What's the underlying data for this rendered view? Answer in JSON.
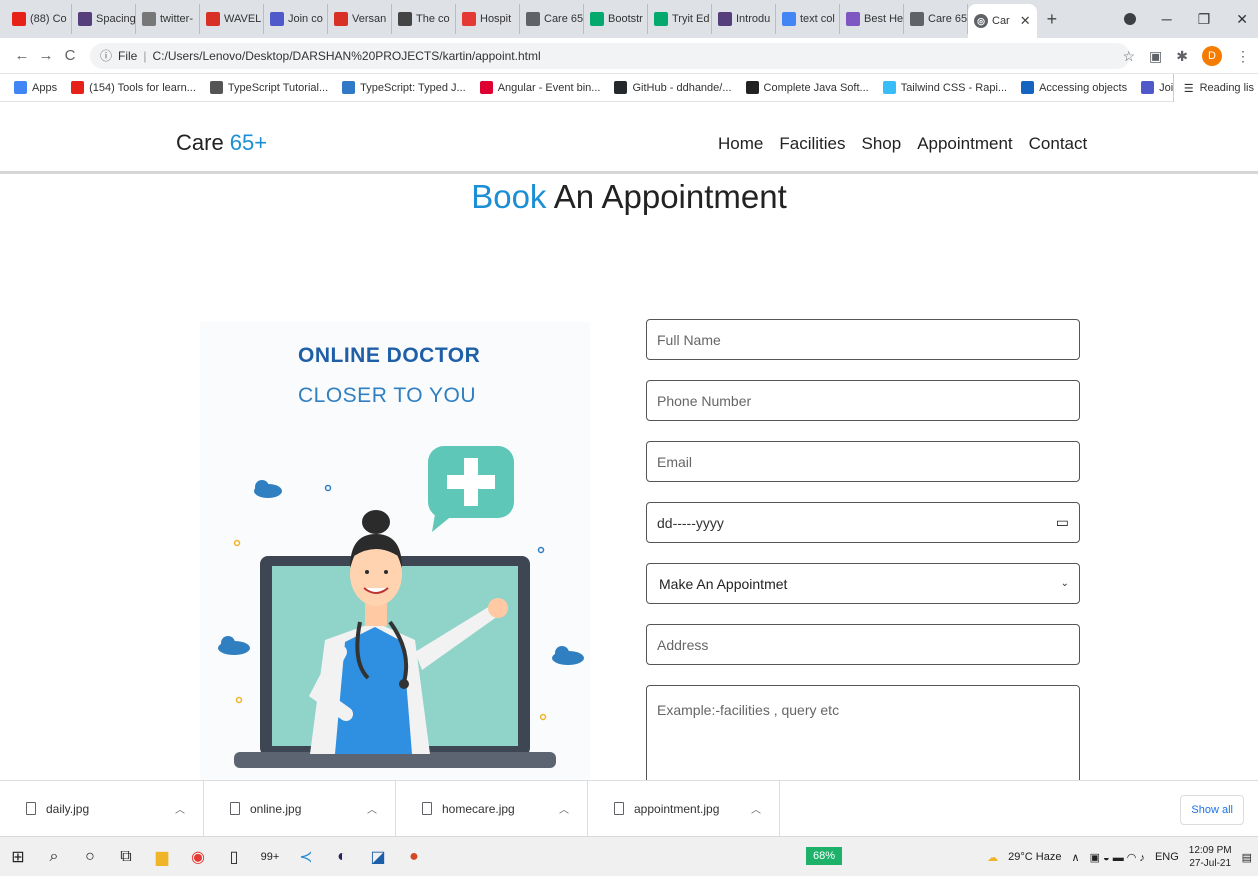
{
  "browser": {
    "tabs": [
      {
        "label": "(88) Co",
        "icon": "youtube-icon",
        "color": "#e62117"
      },
      {
        "label": "Spacing",
        "icon": "bootstrap-icon",
        "color": "#563d7c"
      },
      {
        "label": "twitter-",
        "icon": "code-icon",
        "color": "#777777"
      },
      {
        "label": "WAVEL",
        "icon": "gmail-icon",
        "color": "#d93025"
      },
      {
        "label": "Join co",
        "icon": "teams-icon",
        "color": "#5059c9"
      },
      {
        "label": "Versan",
        "icon": "gmail-icon",
        "color": "#d93025"
      },
      {
        "label": "The co",
        "icon": "arrows-icon",
        "color": "#444444"
      },
      {
        "label": "Hospit",
        "icon": "hospital-icon",
        "color": "#e53935"
      },
      {
        "label": "Care 65",
        "icon": "globe-icon",
        "color": "#5f6368"
      },
      {
        "label": "Bootstr",
        "icon": "w3-icon",
        "color": "#04aa6d"
      },
      {
        "label": "Tryit Ed",
        "icon": "w3-icon",
        "color": "#04aa6d"
      },
      {
        "label": "Introdu",
        "icon": "bootstrap-icon",
        "color": "#563d7c"
      },
      {
        "label": "text col",
        "icon": "google-icon",
        "color": "#4285f4"
      },
      {
        "label": "Best He",
        "icon": "site-icon",
        "color": "#7e57c2"
      },
      {
        "label": "Care 65",
        "icon": "globe-icon",
        "color": "#5f6368"
      }
    ],
    "active_tab": {
      "label": "Car",
      "icon": "globe-icon"
    },
    "address_prefix": "File",
    "url": "C:/Users/Lenovo/Desktop/DARSHAN%20PROJECTS/kartin/appoint.html",
    "avatar_letter": "D",
    "bookmarks": [
      {
        "label": "Apps",
        "icon": "apps-grid-icon",
        "color": "#4285f4"
      },
      {
        "label": "(154) Tools for learn...",
        "icon": "youtube-icon",
        "color": "#e62117"
      },
      {
        "label": "TypeScript Tutorial...",
        "icon": "typescript-diamond-icon",
        "color": "#555555"
      },
      {
        "label": "TypeScript: Typed J...",
        "icon": "ts-icon",
        "color": "#3178c6"
      },
      {
        "label": "Angular - Event bin...",
        "icon": "angular-icon",
        "color": "#dd0031"
      },
      {
        "label": "GitHub - ddhande/...",
        "icon": "github-icon",
        "color": "#24292e"
      },
      {
        "label": "Complete Java Soft...",
        "icon": "udemy-icon",
        "color": "#222222"
      },
      {
        "label": "Tailwind CSS - Rapi...",
        "icon": "tailwind-icon",
        "color": "#38bdf8"
      },
      {
        "label": "Accessing objects",
        "icon": "video-icon",
        "color": "#1565c0"
      },
      {
        "label": "Join conversation",
        "icon": "teams-icon",
        "color": "#5059c9"
      }
    ],
    "reading_list": "Reading lis"
  },
  "site": {
    "brand_text": "Care ",
    "brand_accent": "65+",
    "accent_color": "#1a8fd6",
    "nav": [
      "Home",
      "Facilities",
      "Shop",
      "Appointment",
      "Contact"
    ],
    "heading_accent": "Book",
    "heading_rest": " An Appointment",
    "illustration": {
      "line1": "ONLINE DOCTOR",
      "line2": "CLOSER TO YOU"
    },
    "form": {
      "full_name_placeholder": "Full Name",
      "phone_placeholder": "Phone Number",
      "email_placeholder": "Email",
      "date_placeholder": "dd-----yyyy",
      "select_value": "Make An Appointmet",
      "address_placeholder": "Address",
      "message_placeholder": "Example:-facilities , query etc"
    }
  },
  "downloads": {
    "files": [
      "daily.jpg",
      "online.jpg",
      "homecare.jpg",
      "appointment.jpg"
    ],
    "show_all": "Show all"
  },
  "taskbar": {
    "battery": "68%",
    "weather": "29°C Haze",
    "language": "ENG",
    "time": "12:09 PM",
    "date": "27-Jul-21",
    "notification_badge": "99+"
  }
}
